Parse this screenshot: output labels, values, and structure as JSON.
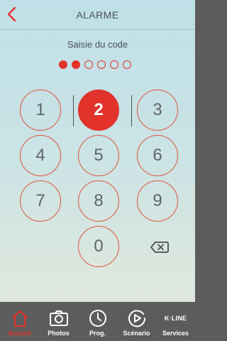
{
  "header": {
    "title": "ALARME"
  },
  "code": {
    "label": "Saisie du code",
    "length": 6,
    "entered": 2
  },
  "keypad": {
    "keys": [
      "1",
      "2",
      "3",
      "4",
      "5",
      "6",
      "7",
      "8",
      "9",
      "0"
    ],
    "active_key": "2"
  },
  "tabbar": {
    "tabs": [
      {
        "label": "Accueil",
        "icon": "home-icon",
        "active": true
      },
      {
        "label": "Photos",
        "icon": "camera-icon",
        "active": false
      },
      {
        "label": "Prog.",
        "icon": "clock-icon",
        "active": false
      },
      {
        "label": "Scénario",
        "icon": "play-icon",
        "active": false
      },
      {
        "label": "Services",
        "icon": "k-line-logo",
        "logo_text": "K·LINE",
        "active": false
      }
    ]
  },
  "colors": {
    "accent": "#e1322b",
    "text": "#4a5052",
    "tabbar": "#5c5c5c"
  }
}
